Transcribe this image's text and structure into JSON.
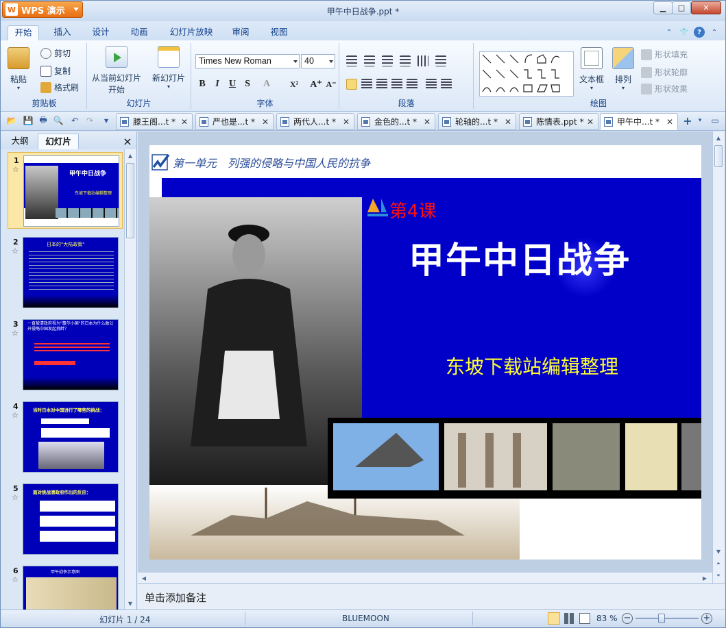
{
  "app": {
    "logo_letter": "W",
    "name": "WPS 演示",
    "window_title": "甲午中日战争.ppt *",
    "controls": {
      "minimize": "▁",
      "maximize": "□",
      "close": "✕"
    }
  },
  "menu": {
    "tabs": [
      "开始",
      "插入",
      "设计",
      "动画",
      "幻灯片放映",
      "审阅",
      "视图"
    ],
    "active": "开始",
    "right_icons": [
      "expand-up-icon",
      "skin-icon",
      "help-icon",
      "collapse-icon"
    ],
    "right_glyphs": [
      "⌃",
      "👕",
      "?",
      "⌃"
    ]
  },
  "ribbon": {
    "clipboard": {
      "paste": "粘贴",
      "cut": "剪切",
      "copy": "复制",
      "format_painter": "格式刷",
      "label": "剪贴板"
    },
    "slides": {
      "from_current": "从当前幻灯片",
      "start": "开始",
      "new_slide": "新幻灯片",
      "label": "幻灯片"
    },
    "font": {
      "name": "Times New Roman",
      "size": "40",
      "label": "字体",
      "bold": "B",
      "italic": "I",
      "underline": "U",
      "shadow": "S",
      "color": "A",
      "superscript": "X²",
      "grow": "A⁺",
      "shrink": "A⁻"
    },
    "paragraph": {
      "label": "段落"
    },
    "drawing": {
      "textbox": "文本框",
      "arrange": "排列",
      "shape_fill": "形状填充",
      "shape_outline": "形状轮廓",
      "shape_effect": "形状效果",
      "label": "绘图"
    }
  },
  "doc_tabs": [
    {
      "label": "滕王阁...t *",
      "active": false
    },
    {
      "label": "严也是...t *",
      "active": false
    },
    {
      "label": "两代人...t *",
      "active": false
    },
    {
      "label": "金色的...t *",
      "active": false
    },
    {
      "label": "轮轴的...t *",
      "active": false
    },
    {
      "label": "陈情表.ppt *",
      "active": false
    },
    {
      "label": "甲午中...t *",
      "active": true
    }
  ],
  "tab_add": "+",
  "panel": {
    "tabs": [
      "大纲",
      "幻灯片"
    ],
    "active": "幻灯片",
    "close": "×",
    "thumbnails": [
      {
        "num": "1",
        "title": "甲午中日战争",
        "sub": "东坡下载站编辑整理"
      },
      {
        "num": "2",
        "title": "日本的\"大陆政策\""
      },
      {
        "num": "3",
        "title": "一直被清政府视为\"蕞尔小国\"的日本为什么敢公开侵略中国发起挑衅？"
      },
      {
        "num": "4",
        "title": "当时日本对中国进行了哪些的挑战："
      },
      {
        "num": "5",
        "title": "面对挑战清政府作出的反应："
      },
      {
        "num": "6",
        "title": "甲午战争示意图"
      }
    ]
  },
  "slide": {
    "unit_title": "第一单元　列强的侵略与中国人民的抗争",
    "lesson": "第4课",
    "title": "甲午中日战争",
    "subtitle": "东坡下载站编辑整理"
  },
  "notes_placeholder": "单击添加备注",
  "status": {
    "slide_counter": "幻灯片 1 / 24",
    "theme": "BLUEMOON",
    "zoom": "83 %",
    "zoom_level": 0.83
  },
  "colors": {
    "slide_blue": "#0000c8",
    "lesson_red": "#ff1010",
    "subtitle_yellow": "#ffff33",
    "ribbon_bg": "#dce8f7"
  }
}
